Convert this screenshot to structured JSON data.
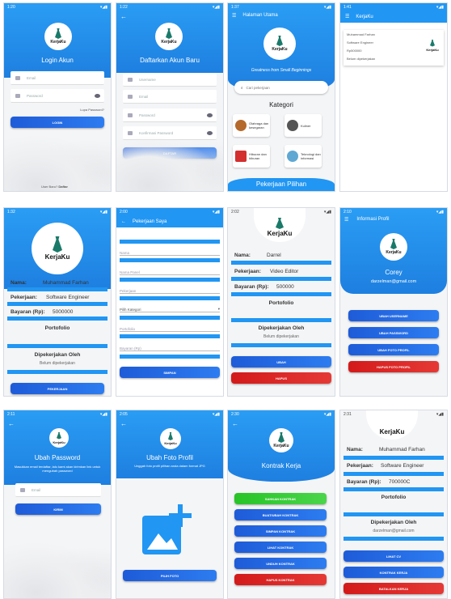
{
  "status": {
    "time1": "1:20",
    "time2": "1:22",
    "time3": "1:37",
    "time4": "1:41",
    "time5": "1:32",
    "time6": "2:00",
    "time7": "2:02",
    "time8": "2:10",
    "time9": "2:11",
    "time10": "2:05",
    "time11": "2:30",
    "time12": "2:31"
  },
  "login": {
    "title": "Login Akun",
    "email_ph": "Email",
    "password_ph": "Password",
    "forgot": "Lupa Password?",
    "button": "LOGIN",
    "register_prompt": "User Baru?",
    "register_link": "Daftar"
  },
  "register": {
    "title": "Daftarkan Akun Baru",
    "username_ph": "Username",
    "email_ph": "Email",
    "password_ph": "Password",
    "confirm_ph": "Konfirmasi Password",
    "button": "DAFTAR"
  },
  "home": {
    "header": "Halaman Utama",
    "tagline": "Greatness from Small Beginnings",
    "search_ph": "Cari pekerjaan",
    "kategori": "Kategori",
    "cat1": "Olahraga dan kesegaran",
    "cat2": "Kuliner",
    "cat3": "Hiburan dan hiburan",
    "cat4": "Teknologi dan informasi",
    "pilihan": "Pekerjaan Pilihan"
  },
  "brand": {
    "name": "KerjaKu"
  },
  "joblist": {
    "line1": "Muhammad Farhan",
    "line2": "Software Engineer",
    "line3": "Rp500000",
    "line4": "Belum dipekerjakan"
  },
  "detail1": {
    "nama_label": "Nama:",
    "nama": "Muhammad Farhan",
    "pek_label": "Pekerjaan:",
    "pek": "Software Engineer",
    "bayar_label": "Bayaran (Rp):",
    "bayar": "5000000",
    "portfolio": "Portofolio",
    "dipek": "Dipekerjakan Oleh",
    "belum": "Belum dipekerjakan",
    "button": "PEKERJAAN"
  },
  "myjob": {
    "header": "Pekerjaan Saya",
    "f1": "Nama",
    "f2": "Nama Panel",
    "f3": "Pekerjaan",
    "f4": "Pilih Kategori",
    "f5": "Portofolio",
    "f6": "Bayaran (Rp)",
    "button": "SIMPAN"
  },
  "detail2": {
    "nama_label": "Nama:",
    "nama": "Darrel",
    "pek_label": "Pekerjaan:",
    "pek": "Video Editor",
    "bayar_label": "Bayaran (Rp):",
    "bayar": "500000",
    "portfolio": "Portofolio",
    "dipek": "Dipekerjakan Oleh",
    "belum": "Belum dipekerjakan",
    "ubah": "UBAH",
    "hapus": "HAPUS"
  },
  "profile": {
    "header": "Informasi Profil",
    "name": "Corey",
    "email": "darzelman@gmail.com",
    "b1": "UBAH USERNAME",
    "b2": "UBAH PASSWORD",
    "b3": "UBAH FOTO PROFIL",
    "b4": "HAPUS FOTO PROFIL"
  },
  "chpass": {
    "title": "Ubah Password",
    "desc": "Masukkan email terdaftar, lalu kami akan kirimkan link untuk mengubah password",
    "email_ph": "Email",
    "button": "KIRIM"
  },
  "chphoto": {
    "title": "Ubah Foto Profil",
    "desc": "Unggah foto profil pilihan anda dalam format JPG",
    "button": "PILIH FOTO"
  },
  "contract": {
    "title": "Kontrak Kerja",
    "b1": "SAHKAN KONTRAK",
    "b2": "BUAT/UBAH KONTRAK",
    "b3": "SIMPAN KONTRAK",
    "b4": "LIHAT KONTRAK",
    "b5": "UNDUH KONTRAK",
    "b6": "HAPUS KONTRAK"
  },
  "detail3": {
    "nama_label": "Nama:",
    "nama": "Muhammad Farhan",
    "pek_label": "Pekerjaan:",
    "pek": "Software Engineer",
    "bayar_label": "Bayaran (Rp):",
    "bayar": "700000C",
    "portfolio": "Portofolio",
    "dipek": "Dipekerjakan Oleh",
    "email": "darzelman@gmail.com",
    "b1": "LIHAT CV",
    "b2": "KONTRAK KERJA",
    "b3": "BATALKAN KERJA"
  },
  "colors": {
    "primary": "#2196F3",
    "button": "#1e5bd8",
    "danger": "#e53935",
    "success": "#4ad54a"
  }
}
